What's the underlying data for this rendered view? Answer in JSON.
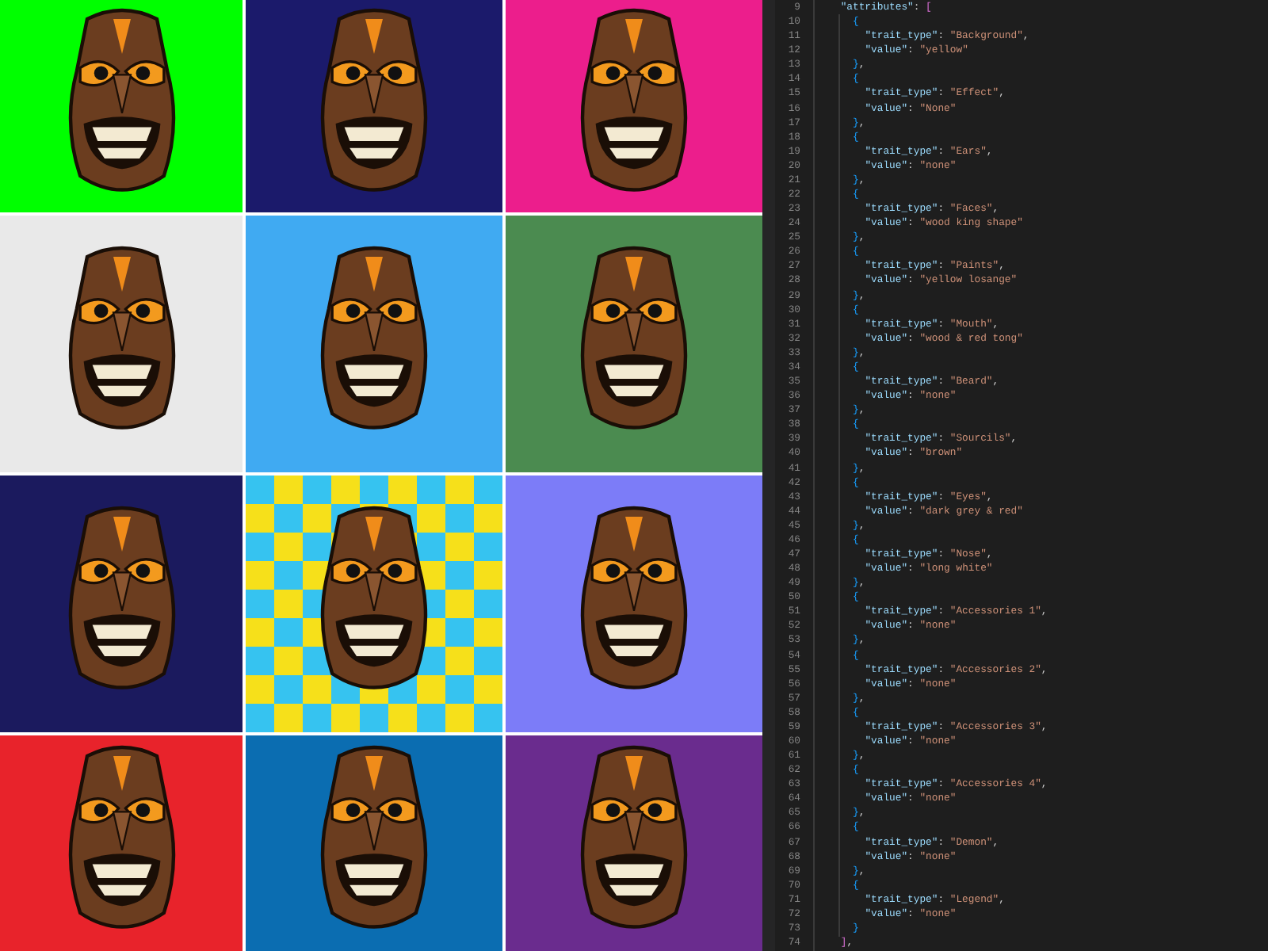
{
  "artworks": [
    {
      "kind": "plain",
      "color": "#00ff00"
    },
    {
      "kind": "plain",
      "color": "#1b1a6b"
    },
    {
      "kind": "plain",
      "color": "#ec1e8c"
    },
    {
      "kind": "plain",
      "color": "#e9e9e9"
    },
    {
      "kind": "plain",
      "color": "#40aaf2"
    },
    {
      "kind": "plain",
      "color": "#4b8b50"
    },
    {
      "kind": "plain",
      "color": "#1b1a5e"
    },
    {
      "kind": "checker",
      "color": "#f6e01a"
    },
    {
      "kind": "plain",
      "color": "#7c7cf8"
    },
    {
      "kind": "plain",
      "color": "#e8232b"
    },
    {
      "kind": "plain",
      "color": "#0b6db1"
    },
    {
      "kind": "plain",
      "color": "#6a2c8e"
    }
  ],
  "editor": {
    "lines": [
      {
        "number": "9",
        "text": "    \"attributes\": ["
      },
      {
        "number": "10",
        "text": "      {"
      },
      {
        "number": "11",
        "text": "        \"trait_type\": \"Background\","
      },
      {
        "number": "12",
        "text": "        \"value\": \"yellow\""
      },
      {
        "number": "13",
        "text": "      },"
      },
      {
        "number": "14",
        "text": "      {"
      },
      {
        "number": "15",
        "text": "        \"trait_type\": \"Effect\","
      },
      {
        "number": "16",
        "text": "        \"value\": \"None\""
      },
      {
        "number": "17",
        "text": "      },"
      },
      {
        "number": "18",
        "text": "      {"
      },
      {
        "number": "19",
        "text": "        \"trait_type\": \"Ears\","
      },
      {
        "number": "20",
        "text": "        \"value\": \"none\""
      },
      {
        "number": "21",
        "text": "      },"
      },
      {
        "number": "22",
        "text": "      {"
      },
      {
        "number": "23",
        "text": "        \"trait_type\": \"Faces\","
      },
      {
        "number": "24",
        "text": "        \"value\": \"wood king shape\""
      },
      {
        "number": "25",
        "text": "      },"
      },
      {
        "number": "26",
        "text": "      {"
      },
      {
        "number": "27",
        "text": "        \"trait_type\": \"Paints\","
      },
      {
        "number": "28",
        "text": "        \"value\": \"yellow losange\""
      },
      {
        "number": "29",
        "text": "      },"
      },
      {
        "number": "30",
        "text": "      {"
      },
      {
        "number": "31",
        "text": "        \"trait_type\": \"Mouth\","
      },
      {
        "number": "32",
        "text": "        \"value\": \"wood & red tong\""
      },
      {
        "number": "33",
        "text": "      },"
      },
      {
        "number": "34",
        "text": "      {"
      },
      {
        "number": "35",
        "text": "        \"trait_type\": \"Beard\","
      },
      {
        "number": "36",
        "text": "        \"value\": \"none\""
      },
      {
        "number": "37",
        "text": "      },"
      },
      {
        "number": "38",
        "text": "      {"
      },
      {
        "number": "39",
        "text": "        \"trait_type\": \"Sourcils\","
      },
      {
        "number": "40",
        "text": "        \"value\": \"brown\""
      },
      {
        "number": "41",
        "text": "      },"
      },
      {
        "number": "42",
        "text": "      {"
      },
      {
        "number": "43",
        "text": "        \"trait_type\": \"Eyes\","
      },
      {
        "number": "44",
        "text": "        \"value\": \"dark grey & red\""
      },
      {
        "number": "45",
        "text": "      },"
      },
      {
        "number": "46",
        "text": "      {"
      },
      {
        "number": "47",
        "text": "        \"trait_type\": \"Nose\","
      },
      {
        "number": "48",
        "text": "        \"value\": \"long white\""
      },
      {
        "number": "49",
        "text": "      },"
      },
      {
        "number": "50",
        "text": "      {"
      },
      {
        "number": "51",
        "text": "        \"trait_type\": \"Accessories 1\","
      },
      {
        "number": "52",
        "text": "        \"value\": \"none\""
      },
      {
        "number": "53",
        "text": "      },"
      },
      {
        "number": "54",
        "text": "      {"
      },
      {
        "number": "55",
        "text": "        \"trait_type\": \"Accessories 2\","
      },
      {
        "number": "56",
        "text": "        \"value\": \"none\""
      },
      {
        "number": "57",
        "text": "      },"
      },
      {
        "number": "58",
        "text": "      {"
      },
      {
        "number": "59",
        "text": "        \"trait_type\": \"Accessories 3\","
      },
      {
        "number": "60",
        "text": "        \"value\": \"none\""
      },
      {
        "number": "61",
        "text": "      },"
      },
      {
        "number": "62",
        "text": "      {"
      },
      {
        "number": "63",
        "text": "        \"trait_type\": \"Accessories 4\","
      },
      {
        "number": "64",
        "text": "        \"value\": \"none\""
      },
      {
        "number": "65",
        "text": "      },"
      },
      {
        "number": "66",
        "text": "      {"
      },
      {
        "number": "67",
        "text": "        \"trait_type\": \"Demon\","
      },
      {
        "number": "68",
        "text": "        \"value\": \"none\""
      },
      {
        "number": "69",
        "text": "      },"
      },
      {
        "number": "70",
        "text": "      {"
      },
      {
        "number": "71",
        "text": "        \"trait_type\": \"Legend\","
      },
      {
        "number": "72",
        "text": "        \"value\": \"none\""
      },
      {
        "number": "73",
        "text": "      }"
      },
      {
        "number": "74",
        "text": "    ],"
      }
    ]
  }
}
